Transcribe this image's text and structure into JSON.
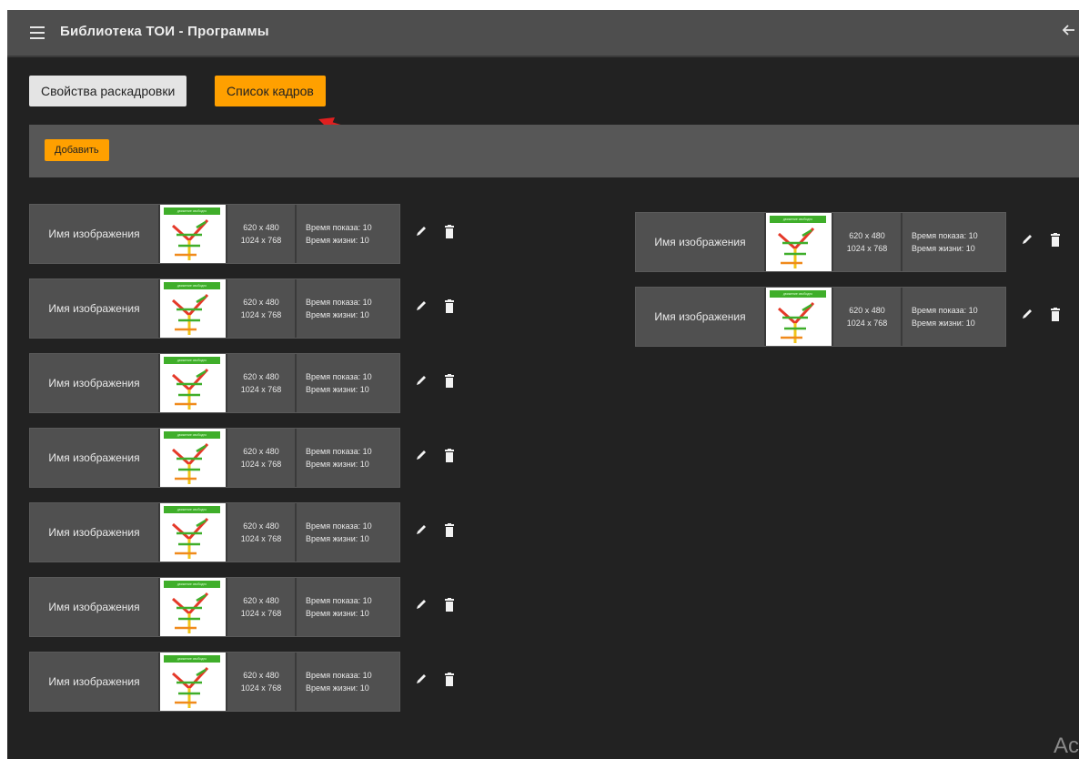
{
  "app": {
    "title": "Библиотека ТОИ - Программы"
  },
  "tabs": [
    {
      "label": "Свойства раскадровки",
      "active": false
    },
    {
      "label": "Список кадров",
      "active": true
    }
  ],
  "toolbar": {
    "add_label": "Добавить"
  },
  "frames_left": [
    {
      "name": "Имя изображения",
      "thumb_caption": "движение свободно",
      "size_a": "620 x 480",
      "size_b": "1024 x 768",
      "show_time": "Время показа: 10",
      "life_time": "Время жизни: 10"
    },
    {
      "name": "Имя изображения",
      "thumb_caption": "движение свободно",
      "size_a": "620 x 480",
      "size_b": "1024 x 768",
      "show_time": "Время показа: 10",
      "life_time": "Время жизни: 10"
    },
    {
      "name": "Имя изображения",
      "thumb_caption": "движение свободно",
      "size_a": "620 x 480",
      "size_b": "1024 x 768",
      "show_time": "Время показа: 10",
      "life_time": "Время жизни: 10"
    },
    {
      "name": "Имя изображения",
      "thumb_caption": "движение свободно",
      "size_a": "620 x 480",
      "size_b": "1024 x 768",
      "show_time": "Время показа: 10",
      "life_time": "Время жизни: 10"
    },
    {
      "name": "Имя изображения",
      "thumb_caption": "движение свободно",
      "size_a": "620 x 480",
      "size_b": "1024 x 768",
      "show_time": "Время показа: 10",
      "life_time": "Время жизни: 10"
    },
    {
      "name": "Имя изображения",
      "thumb_caption": "движение свободно",
      "size_a": "620 x 480",
      "size_b": "1024 x 768",
      "show_time": "Время показа: 10",
      "life_time": "Время жизни: 10"
    },
    {
      "name": "Имя изображения",
      "thumb_caption": "движение свободно",
      "size_a": "620 x 480",
      "size_b": "1024 x 768",
      "show_time": "Время показа: 10",
      "life_time": "Время жизни: 10"
    }
  ],
  "frames_right": [
    {
      "name": "Имя изображения",
      "thumb_caption": "движение свободно",
      "size_a": "620 x 480",
      "size_b": "1024 x 768",
      "show_time": "Время показа: 10",
      "life_time": "Время жизни: 10"
    },
    {
      "name": "Имя изображения",
      "thumb_caption": "движение свободно",
      "size_a": "620 x 480",
      "size_b": "1024 x 768",
      "show_time": "Время показа: 10",
      "life_time": "Время жизни: 10"
    }
  ],
  "corner_text": "Ac",
  "icons": {
    "menu": "menu-icon",
    "back": "arrow-left-icon",
    "edit": "pencil-icon",
    "delete": "trash-icon"
  },
  "colors": {
    "accent": "#ffa000",
    "topbar": "#4e4e4e",
    "background": "#222222",
    "annotation_arrow": "#e02020"
  }
}
